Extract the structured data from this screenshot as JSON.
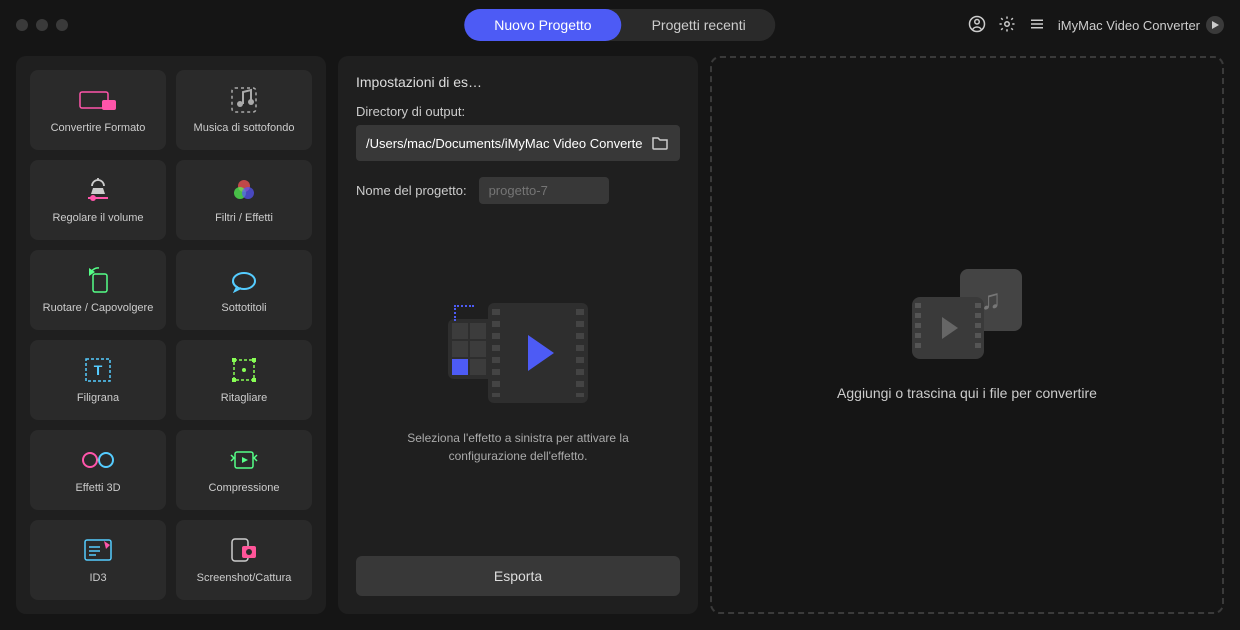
{
  "titlebar": {
    "tabs": {
      "new": "Nuovo Progetto",
      "recent": "Progetti recenti"
    },
    "brand": "iMyMac Video Converter"
  },
  "effects": [
    {
      "id": "convert-format",
      "label": "Convertire Formato"
    },
    {
      "id": "background-music",
      "label": "Musica di sottofondo"
    },
    {
      "id": "adjust-volume",
      "label": "Regolare il volume"
    },
    {
      "id": "filters-effects",
      "label": "Filtri / Effetti"
    },
    {
      "id": "rotate-flip",
      "label": "Ruotare / Capovolgere"
    },
    {
      "id": "subtitles",
      "label": "Sottotitoli"
    },
    {
      "id": "watermark",
      "label": "Filigrana"
    },
    {
      "id": "crop",
      "label": "Ritagliare"
    },
    {
      "id": "3d-effects",
      "label": "Effetti 3D"
    },
    {
      "id": "compression",
      "label": "Compressione"
    },
    {
      "id": "id3",
      "label": "ID3"
    },
    {
      "id": "screenshot-capture",
      "label": "Screenshot/Cattura"
    }
  ],
  "export": {
    "section_title": "Impostazioni di es…",
    "output_label": "Directory di output:",
    "output_path": "/Users/mac/Documents/iMyMac Video Converte",
    "name_label": "Nome del progetto:",
    "name_placeholder": "progetto-7",
    "hint": "Seleziona l'effetto a sinistra per attivare la configurazione dell'effetto.",
    "button": "Esporta"
  },
  "drop": {
    "text": "Aggiungi o trascina qui i file per convertire"
  }
}
